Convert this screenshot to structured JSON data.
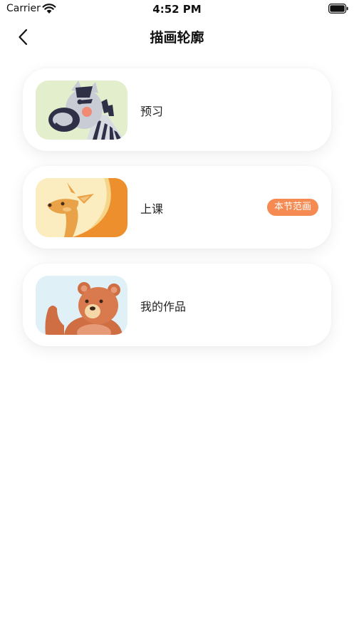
{
  "status_bar": {
    "carrier": "Carrier",
    "time": "4:52 PM"
  },
  "nav": {
    "title": "描画轮廓",
    "back_icon": "chevron-left-icon"
  },
  "cards": [
    {
      "label": "预习",
      "thumbnail": "zebra-illustration",
      "thumb_bg": "#e3efcc"
    },
    {
      "label": "上课",
      "thumbnail": "kangaroo-illustration",
      "thumb_bg": "#fbedbf",
      "badge": "本节范画",
      "badge_color": "#f58a52"
    },
    {
      "label": "我的作品",
      "thumbnail": "bear-illustration",
      "thumb_bg": "#dff0f7"
    }
  ]
}
